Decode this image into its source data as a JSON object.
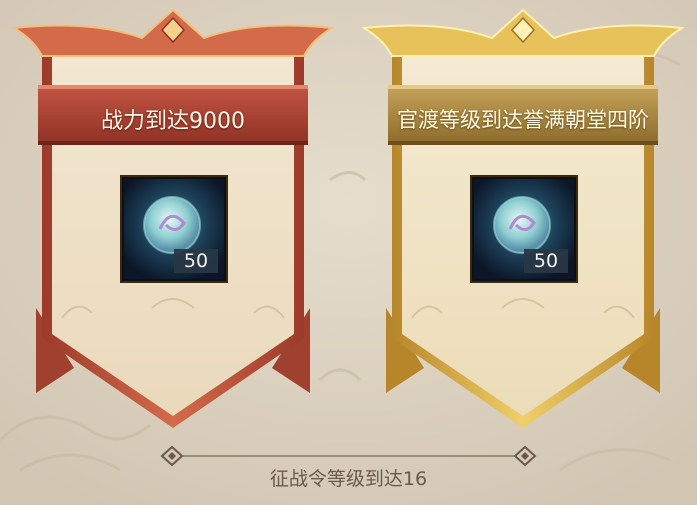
{
  "rewards": [
    {
      "condition": "战力到达9000",
      "item_icon": "jade-orb-icon",
      "quantity": "50",
      "theme_color": "#b84a3c"
    },
    {
      "condition": "官渡等级到达誉满朝堂四阶",
      "item_icon": "jade-orb-icon",
      "quantity": "50",
      "theme_color": "#c9a23a"
    }
  ],
  "footer": {
    "requirement": "征战令等级到达16"
  }
}
